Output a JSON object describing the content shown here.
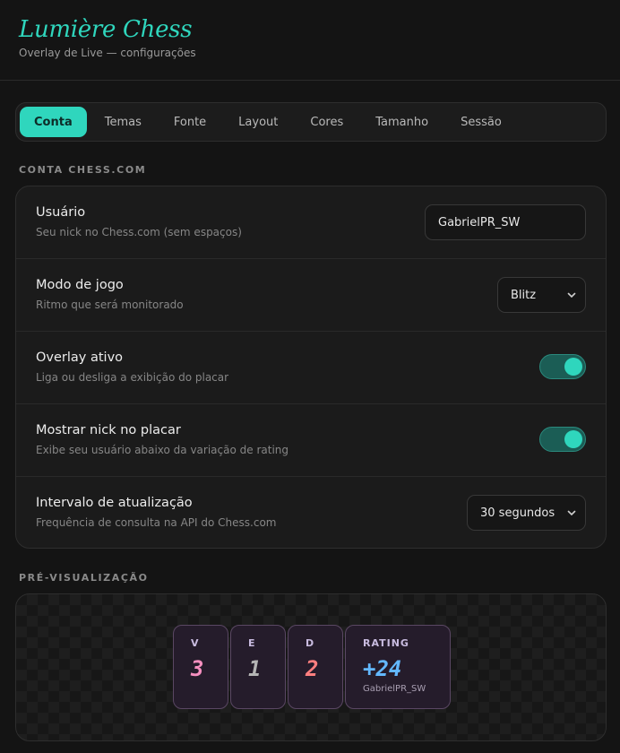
{
  "header": {
    "title": "Lumière Chess",
    "subtitle": "Overlay de Live — configurações"
  },
  "tabs": [
    {
      "label": "Conta",
      "active": true
    },
    {
      "label": "Temas"
    },
    {
      "label": "Fonte"
    },
    {
      "label": "Layout"
    },
    {
      "label": "Cores"
    },
    {
      "label": "Tamanho"
    },
    {
      "label": "Sessão"
    }
  ],
  "account": {
    "section_label": "CONTA CHESS.COM",
    "user": {
      "title": "Usuário",
      "desc": "Seu nick no Chess.com (sem espaços)",
      "value": "GabrielPR_SW"
    },
    "mode": {
      "title": "Modo de jogo",
      "desc": "Ritmo que será monitorado",
      "selected": "Blitz"
    },
    "overlay": {
      "title": "Overlay ativo",
      "desc": "Liga ou desliga a exibição do placar",
      "on": true
    },
    "show_nick": {
      "title": "Mostrar nick no placar",
      "desc": "Exibe seu usuário abaixo da variação de rating",
      "on": true
    },
    "interval": {
      "title": "Intervalo de atualização",
      "desc": "Frequência de consulta na API do Chess.com",
      "selected": "30 segundos"
    }
  },
  "preview": {
    "section_label": "PRÉ-VISUALIZAÇÃO",
    "wins": {
      "label": "V",
      "value": "3",
      "color": "#f58fbf"
    },
    "draws": {
      "label": "E",
      "value": "1",
      "color": "#b5b5b5"
    },
    "losses": {
      "label": "D",
      "value": "2",
      "color": "#ff7f7f"
    },
    "rating": {
      "label": "RATING",
      "value": "+24",
      "color": "#63b8ff",
      "nick": "GabrielPR_SW"
    }
  },
  "colors": {
    "accent": "#2fd6bd",
    "background": "#141414",
    "card": "#1b1b1b"
  }
}
